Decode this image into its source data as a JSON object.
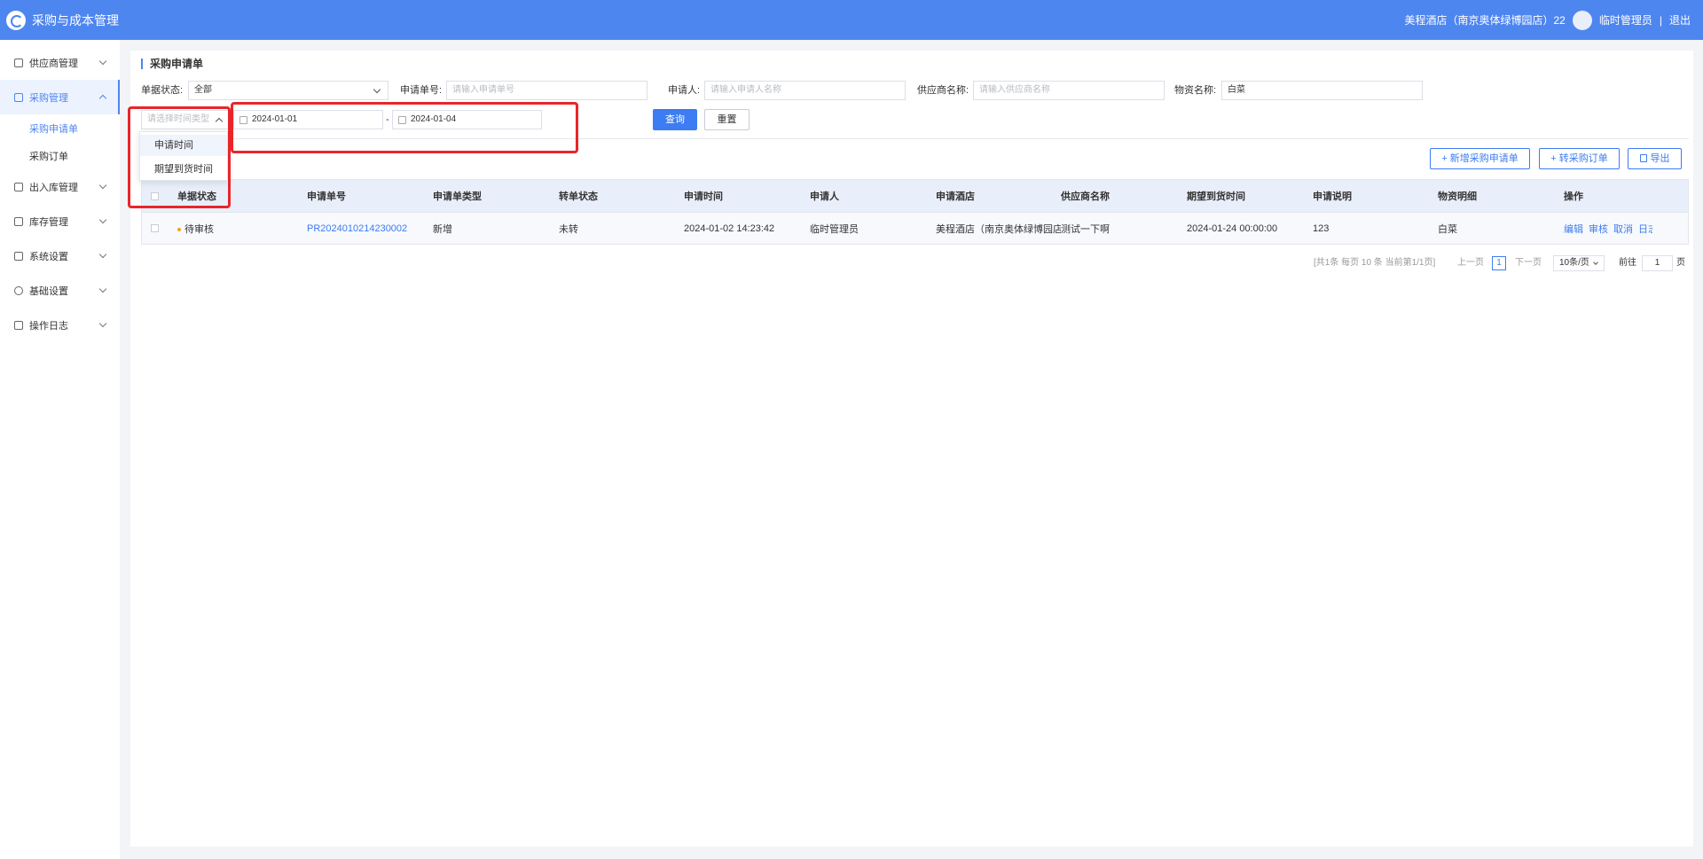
{
  "header": {
    "app_title": "采购与成本管理",
    "hotel": "美程酒店（南京奥体绿博园店）22",
    "username": "临时管理员",
    "separator": "|",
    "logout": "退出"
  },
  "sidebar": {
    "items": [
      {
        "label": "供应商管理",
        "icon": "supplier-icon"
      },
      {
        "label": "采购管理",
        "icon": "purchase-icon"
      },
      {
        "label": "出入库管理",
        "icon": "inout-icon"
      },
      {
        "label": "库存管理",
        "icon": "inventory-icon"
      },
      {
        "label": "系统设置",
        "icon": "system-icon"
      },
      {
        "label": "基础设置",
        "icon": "gear-icon"
      },
      {
        "label": "操作日志",
        "icon": "log-icon"
      }
    ],
    "sub_items": [
      "采购申请单",
      "采购订单"
    ]
  },
  "page": {
    "title": "采购申请单"
  },
  "filters": {
    "status_label": "单据状态:",
    "status_value": "全部",
    "order_no_label": "申请单号:",
    "order_no_placeholder": "请输入申请单号",
    "applicant_label": "申请人:",
    "applicant_placeholder": "请输入申请人名称",
    "supplier_label": "供应商名称:",
    "supplier_placeholder": "请输入供应商名称",
    "material_label": "物资名称:",
    "material_value": "白菜",
    "time_type_placeholder": "请选择时间类型",
    "date_from": "2024-01-01",
    "date_sep": "-",
    "date_to": "2024-01-04",
    "query_label": "查询",
    "reset_label": "重置"
  },
  "dropdown": {
    "options": [
      "申请时间",
      "期望到货时间"
    ]
  },
  "toolbar": {
    "add_label": "+ 新增采购申请单",
    "convert_label": "+ 转采购订单",
    "export_label": "导出"
  },
  "table": {
    "columns": [
      "单据状态",
      "申请单号",
      "申请单类型",
      "转单状态",
      "申请时间",
      "申请人",
      "申请酒店",
      "供应商名称",
      "期望到货时间",
      "申请说明",
      "物资明细",
      "操作"
    ],
    "rows": [
      {
        "status": "待审核",
        "order_no": "PR2024010214230002",
        "type": "新增",
        "convert_status": "未转",
        "apply_time": "2024-01-02 14:23:42",
        "applicant": "临时管理员",
        "hotel": "美程酒店（南京奥体绿博园店）",
        "supplier": "测试一下啊",
        "expected_time": "2024-01-24 00:00:00",
        "remark": "123",
        "material": "白菜",
        "actions": [
          "编辑",
          "审核",
          "取消",
          "日志"
        ]
      }
    ]
  },
  "pagination": {
    "summary": "[共1条 每页 10 条 当前第1/1页]",
    "prev": "上一页",
    "current": "1",
    "next": "下一页",
    "page_size": "10条/页",
    "goto_label": "前往",
    "goto_value": "1",
    "page_unit": "页"
  },
  "colors": {
    "header": "#4e86f0",
    "accent": "#3d7cf2",
    "annotation": "#e8262a",
    "pending_dot": "#f0a020"
  }
}
